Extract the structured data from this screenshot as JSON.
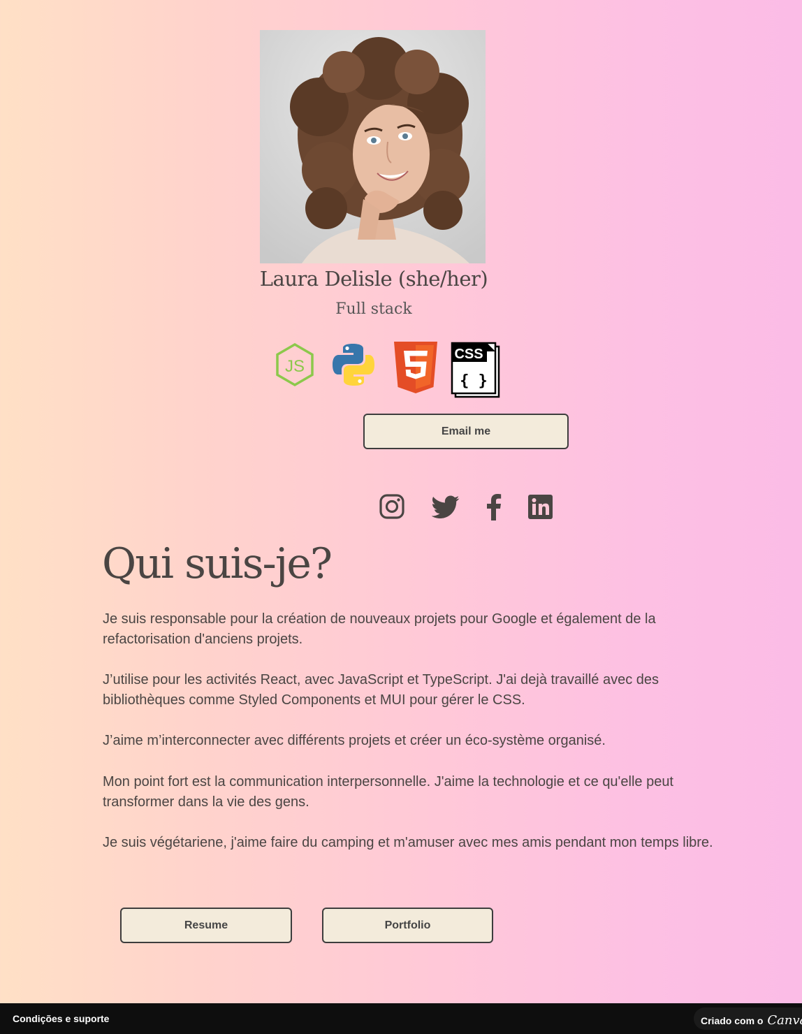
{
  "profile": {
    "photo_alt": "Laura Delisle",
    "name": "Laura Delisle (she/her)",
    "role": "Full stack"
  },
  "tech_icons": [
    "nodejs-icon",
    "python-icon",
    "html5-icon",
    "css-icon"
  ],
  "tech": {
    "css_label": "CSS",
    "css_braces": "{ }"
  },
  "buttons": {
    "email": "Email me",
    "resume": "Resume",
    "portfolio": "Portfolio"
  },
  "social_icons": [
    "instagram-icon",
    "twitter-icon",
    "facebook-icon",
    "linkedin-icon"
  ],
  "about": {
    "title": "Qui suis-je?",
    "paragraphs": [
      "Je suis responsable pour la création de nouveaux projets pour Google et également de la refactorisation d'anciens projets.",
      "J’utilise pour les activités React, avec JavaScript et TypeScript. J'ai dejà  travaillé avec des bibliothèques comme Styled Components et MUI pour gérer le CSS.",
      "J’aime m’interconnecter avec différents projets et créer un éco-système organisé.",
      "Mon point fort est la communication interpersonnelle. J'aime la technologie et ce qu'elle peut transformer dans la vie des gens.",
      "Je suis végétariene, j'aime faire du camping et m'amuser avec mes amis pendant mon temps libre."
    ]
  },
  "footer": {
    "terms": "Condições e suporte",
    "made_with": "Criado com o",
    "brand": "Canva"
  },
  "colors": {
    "button_bg": "#f3ebdb",
    "text": "#4a4543",
    "footer_bg": "#0e0e0e"
  }
}
